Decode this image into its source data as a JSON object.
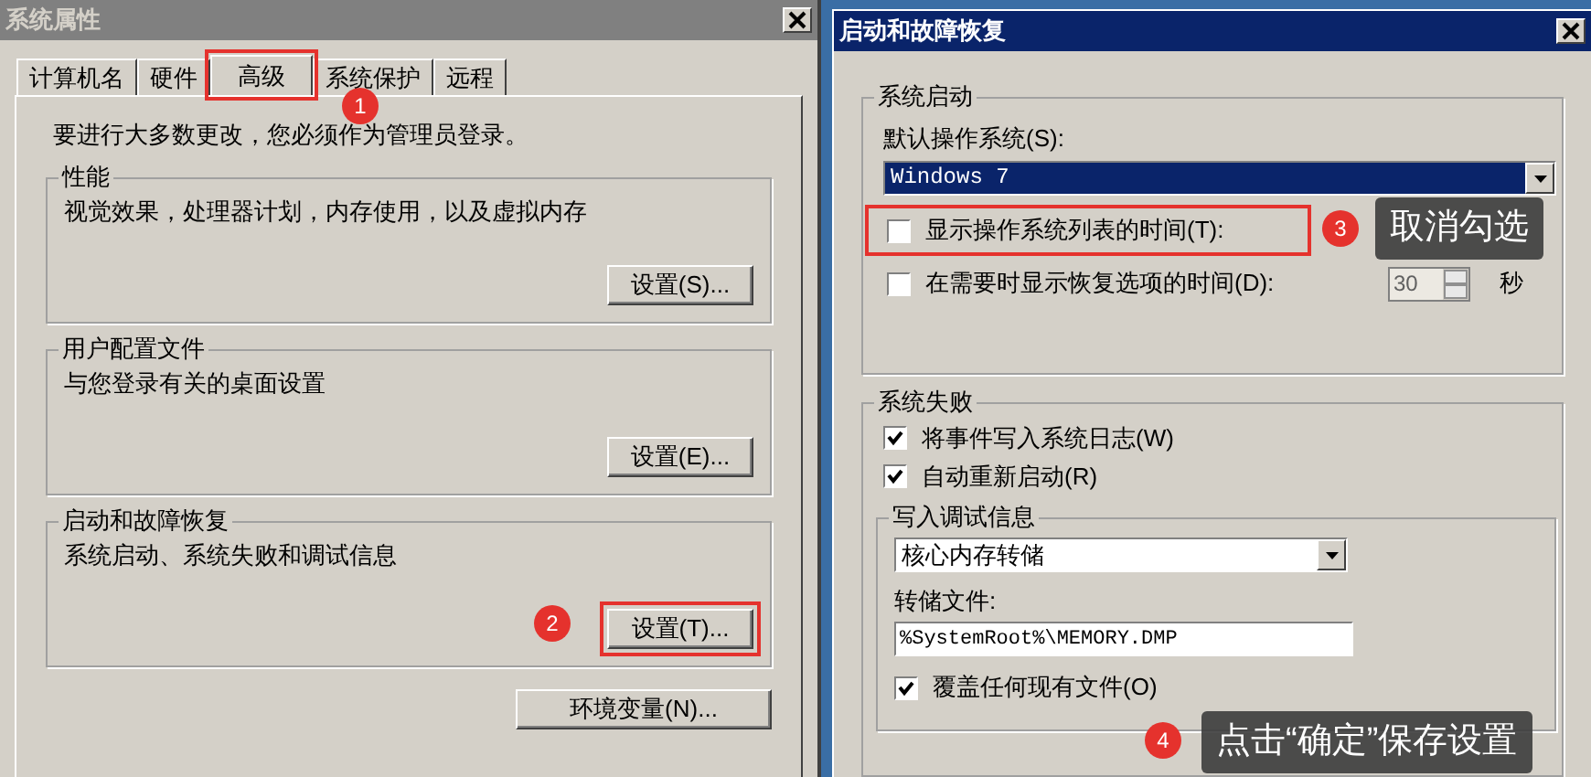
{
  "system_properties": {
    "title": "系统属性",
    "tabs": [
      {
        "label": "计算机名",
        "selected": false,
        "highlighted": false
      },
      {
        "label": "硬件",
        "selected": false,
        "highlighted": false
      },
      {
        "label": "高级",
        "selected": true,
        "highlighted": true
      },
      {
        "label": "系统保护",
        "selected": false,
        "highlighted": false
      },
      {
        "label": "远程",
        "selected": false,
        "highlighted": false
      }
    ],
    "note": "要进行大多数更改，您必须作为管理员登录。",
    "groups": [
      {
        "title": "性能",
        "description": "视觉效果，处理器计划，内存使用，以及虚拟内存",
        "button": "设置(S)...",
        "highlighted": false
      },
      {
        "title": "用户配置文件",
        "description": "与您登录有关的桌面设置",
        "button": "设置(E)...",
        "highlighted": false
      },
      {
        "title": "启动和故障恢复",
        "description": "系统启动、系统失败和调试信息",
        "button": "设置(T)...",
        "highlighted": true
      }
    ],
    "env_button": "环境变量(N)..."
  },
  "startup_recovery": {
    "title": "启动和故障恢复",
    "system_startup": {
      "title": "系统启动",
      "default_os_label": "默认操作系统(S):",
      "default_os": "Windows 7",
      "options": [
        {
          "label": "显示操作系统列表的时间(T):",
          "checked": false,
          "highlighted": true
        },
        {
          "label": "在需要时显示恢复选项的时间(D):",
          "checked": false,
          "highlighted": false,
          "seconds": "30",
          "unit": "秒"
        }
      ]
    },
    "system_failure": {
      "title": "系统失败",
      "options": [
        {
          "label": "将事件写入系统日志(W)",
          "checked": true
        },
        {
          "label": "自动重新启动(R)",
          "checked": true
        }
      ],
      "debug_info": {
        "title": "写入调试信息",
        "dump_type": "核心内存转储",
        "dump_file_label": "转储文件:",
        "dump_file": "%SystemRoot%\\MEMORY.DMP",
        "overwrite": {
          "label": "覆盖任何现有文件(O)",
          "checked": true
        }
      }
    }
  },
  "annotations": [
    {
      "number": "1"
    },
    {
      "number": "2"
    },
    {
      "number": "3",
      "note": "取消勾选"
    },
    {
      "number": "4",
      "note": "点击“确定”保存设置"
    }
  ]
}
